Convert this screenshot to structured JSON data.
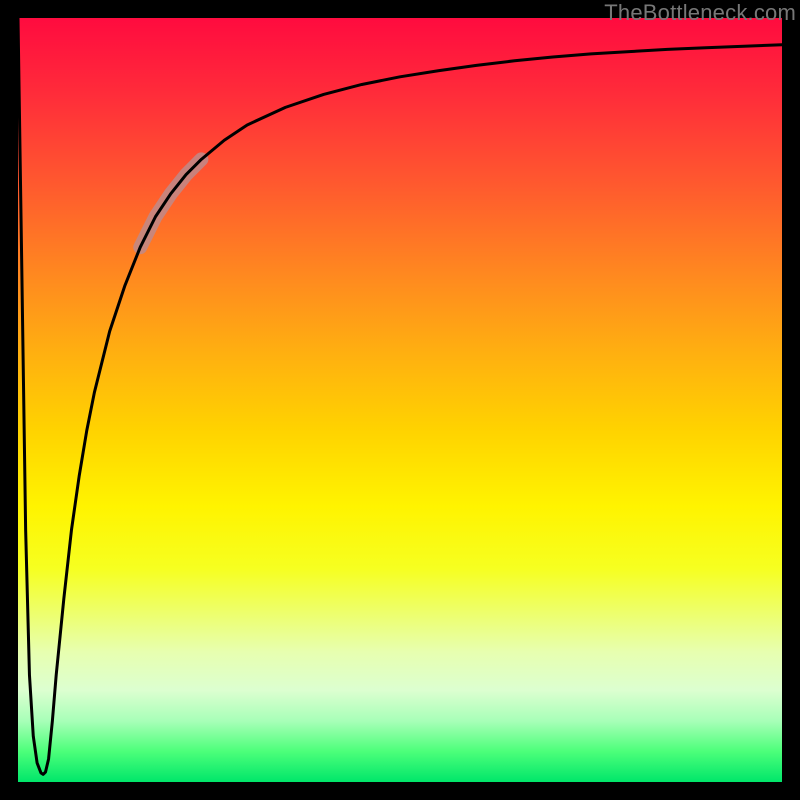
{
  "watermark": {
    "text": "TheBottleneck.com"
  },
  "colors": {
    "background": "#000000",
    "gradient_top": "#ff0b3f",
    "gradient_bottom": "#00e66a",
    "curve": "#000000",
    "highlight": "#c08a8a"
  },
  "chart_data": {
    "type": "line",
    "title": "",
    "xlabel": "",
    "ylabel": "",
    "xlim": [
      0,
      100
    ],
    "ylim": [
      0,
      100
    ],
    "grid": false,
    "annotations": [
      {
        "kind": "highlight-segment",
        "x_start": 16,
        "x_end": 24
      }
    ],
    "series": [
      {
        "name": "curve",
        "x": [
          0,
          0.5,
          1,
          1.5,
          2,
          2.5,
          3,
          3.3,
          3.6,
          4,
          4.5,
          5,
          6,
          7,
          8,
          9,
          10,
          12,
          14,
          16,
          18,
          20,
          22,
          24,
          27,
          30,
          35,
          40,
          45,
          50,
          55,
          60,
          65,
          70,
          75,
          80,
          85,
          90,
          95,
          100
        ],
        "y": [
          100,
          67,
          33,
          14,
          6,
          2.5,
          1.2,
          1.0,
          1.3,
          3,
          8,
          14,
          24,
          33,
          40,
          46,
          51,
          59,
          65,
          70,
          74,
          77,
          79.5,
          81.5,
          84,
          86,
          88.3,
          90,
          91.3,
          92.3,
          93.1,
          93.8,
          94.4,
          94.9,
          95.3,
          95.6,
          95.9,
          96.1,
          96.3,
          96.5
        ]
      }
    ]
  }
}
